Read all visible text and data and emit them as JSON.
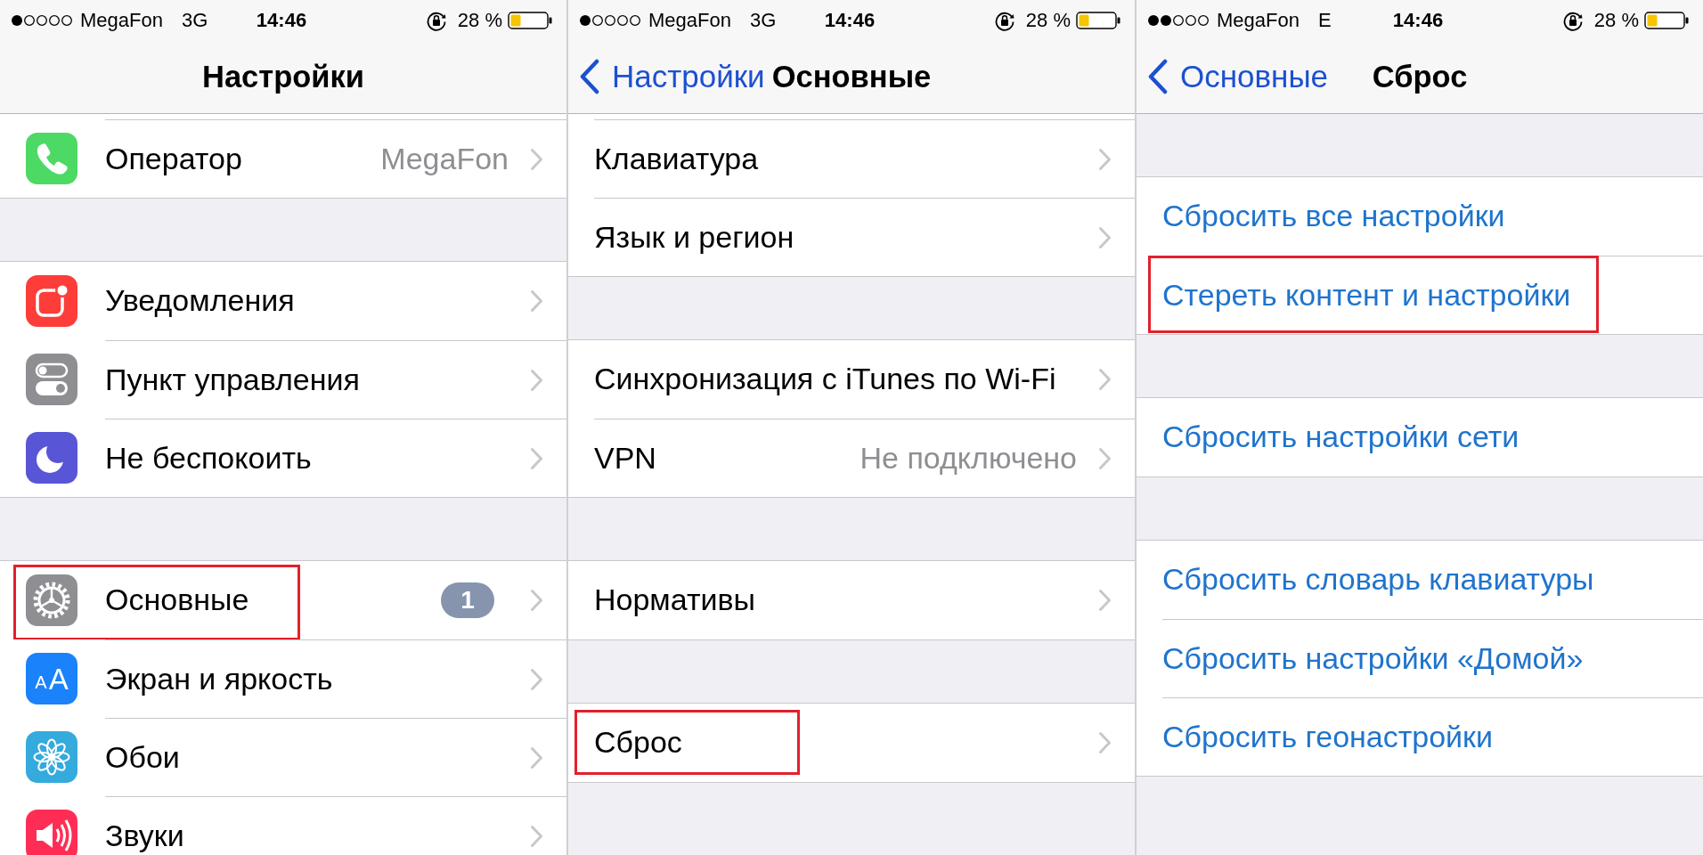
{
  "screens": [
    {
      "status_bar": {
        "signal": [
          {
            "filled": true
          },
          {
            "filled": false
          },
          {
            "filled": false
          },
          {
            "filled": false
          },
          {
            "filled": false
          }
        ],
        "carrier": "MegaFon",
        "network": "3G",
        "time": "14:46",
        "battery": "28 %"
      },
      "nav_bar": {
        "title": "Настройки"
      },
      "scrolled": true,
      "groups": [
        {
          "rows": [
            {
              "kind": "icon_link",
              "label": "Оператор",
              "value": "MegaFon",
              "highlighted": false
            }
          ]
        },
        {
          "rows": [
            {
              "kind": "icon_link",
              "label": "Уведомления",
              "highlighted": false
            },
            {
              "kind": "icon_link",
              "label": "Пункт управления",
              "highlighted": false
            },
            {
              "kind": "icon_link",
              "label": "Не беспокоить",
              "highlighted": false
            }
          ]
        },
        {
          "rows": [
            {
              "kind": "icon_link",
              "label": "Основные",
              "badge": "1",
              "highlighted": true
            },
            {
              "kind": "icon_link",
              "icon_text": [
                "A",
                "A"
              ],
              "label": "Экран и яркость",
              "highlighted": false
            },
            {
              "kind": "icon_link",
              "label": "Обои",
              "highlighted": false
            },
            {
              "kind": "icon_link",
              "label": "Звуки",
              "highlighted": false
            }
          ]
        }
      ]
    },
    {
      "status_bar": {
        "signal": [
          {
            "filled": true
          },
          {
            "filled": false
          },
          {
            "filled": false
          },
          {
            "filled": false
          },
          {
            "filled": false
          }
        ],
        "carrier": "MegaFon",
        "network": "3G",
        "time": "14:46",
        "battery": "28 %"
      },
      "nav_bar": {
        "back": "Настройки",
        "title": "Основные"
      },
      "scrolled": true,
      "groups": [
        {
          "rows": [
            {
              "kind": "link",
              "label": "Клавиатура",
              "highlighted": false
            },
            {
              "kind": "link",
              "label": "Язык и регион",
              "highlighted": false
            }
          ]
        },
        {
          "rows": [
            {
              "kind": "link",
              "label": "Синхронизация с iTunes по Wi-Fi",
              "highlighted": false
            },
            {
              "kind": "link",
              "label": "VPN",
              "value": "Не подключено",
              "highlighted": false
            }
          ]
        },
        {
          "rows": [
            {
              "kind": "link",
              "label": "Нормативы",
              "highlighted": false
            }
          ]
        },
        {
          "rows": [
            {
              "kind": "link",
              "label": "Сброс",
              "highlighted": true
            }
          ]
        }
      ]
    },
    {
      "status_bar": {
        "signal": [
          {
            "filled": true
          },
          {
            "filled": true
          },
          {
            "filled": false
          },
          {
            "filled": false
          },
          {
            "filled": false
          }
        ],
        "carrier": "MegaFon",
        "network": "E",
        "time": "14:46",
        "battery": "28 %"
      },
      "nav_bar": {
        "back": "Основные",
        "title": "Сброс"
      },
      "scrolled": false,
      "groups": [
        {
          "rows": [
            {
              "kind": "action",
              "label": "Сбросить все настройки",
              "highlighted": false
            },
            {
              "kind": "action",
              "label": "Стереть контент и настройки",
              "highlighted": true
            }
          ]
        },
        {
          "rows": [
            {
              "kind": "action",
              "label": "Сбросить настройки сети",
              "highlighted": false
            }
          ]
        },
        {
          "rows": [
            {
              "kind": "action",
              "label": "Сбросить словарь клавиатуры",
              "highlighted": false
            },
            {
              "kind": "action",
              "label": "Сбросить настройки «Домой»",
              "highlighted": false
            },
            {
              "kind": "action",
              "label": "Сбросить геонастройки",
              "highlighted": false
            }
          ]
        }
      ]
    }
  ]
}
